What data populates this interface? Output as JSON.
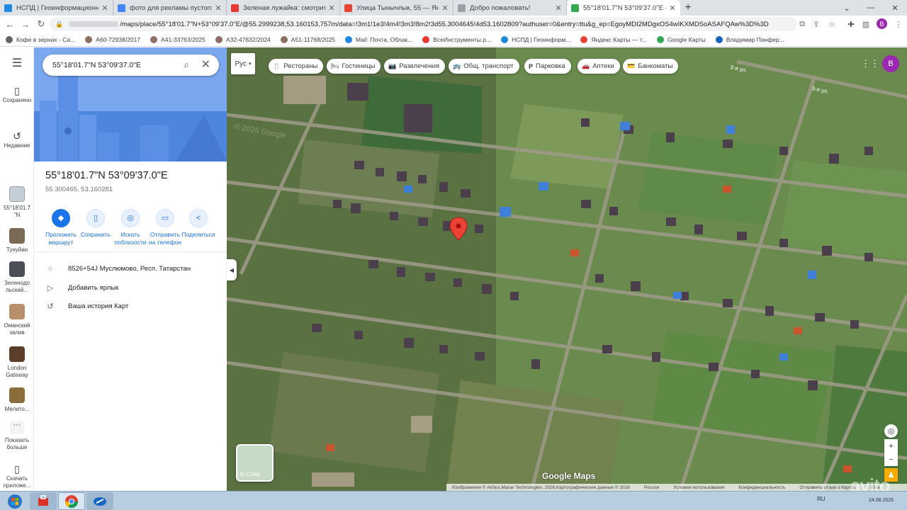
{
  "browser": {
    "tabs": [
      {
        "title": "НСПД | Геоинформационный п",
        "icon_color": "#1e88e5",
        "close": "✕"
      },
      {
        "title": "фото для рекламы пустого учас",
        "icon_color": "#4285f4",
        "close": "✕"
      },
      {
        "title": "Зеленая лужайка: смотрите и с",
        "icon_color": "#e53935",
        "close": "✕"
      },
      {
        "title": "Улица Тынычлык, 55 — Яндекс",
        "icon_color": "#ea4335",
        "close": "✕"
      },
      {
        "title": "Добро пожаловать!",
        "icon_color": "#9aa0a6",
        "close": "✕"
      },
      {
        "title": "55°18'01.7\"N 53°09'37.0\"E – Goo",
        "icon_color": "#34a853",
        "close": "✕",
        "active": true
      }
    ],
    "new_tab": "+",
    "url_visible": "/maps/place/55°18'01.7\"N+53°09'37.0\"E/@55.2999238,53.160153,757m/data=!3m1!1e3!4m4!3m3!8m2!3d55.3004645!4d53.1602809?authuser=0&entry=ttu&g_ep=EgoyMDI2MDgxOS4wIKXMDSoASAFQAw%3D%3D",
    "profile_letter": "B",
    "bookmarks": [
      {
        "label": "Кофе в зернах - Са...",
        "color": "#5f6368"
      },
      {
        "label": "А60-72938/2017",
        "color": "#8d6e63"
      },
      {
        "label": "А41-33763/2025",
        "color": "#8d6e63"
      },
      {
        "label": "А32-47632/2024",
        "color": "#8d6e63"
      },
      {
        "label": "А51-11768/2025",
        "color": "#8d6e63"
      },
      {
        "label": "Mail: Почта, Облак...",
        "color": "#1e88e5"
      },
      {
        "label": "ВсеИнструменты.р...",
        "color": "#e53935"
      },
      {
        "label": "НСПД | Геоинформ...",
        "color": "#1e88e5"
      },
      {
        "label": "Яндекс Карты — т...",
        "color": "#ea4335"
      },
      {
        "label": "Google Карты",
        "color": "#34a853"
      },
      {
        "label": "Владимир Панфер...",
        "color": "#1565c0"
      }
    ]
  },
  "rail": {
    "saved": "Сохранено",
    "recent": "Недавние",
    "items": [
      {
        "label": "55°18'01.7 \"N",
        "color": "#c5cfd8"
      },
      {
        "label": "Тунуйан",
        "color": "#7a6a55"
      },
      {
        "label": "Зеленодольский...",
        "color": "#4a4f58"
      },
      {
        "label": "Оманский залив",
        "color": "#b88f6b"
      },
      {
        "label": "London Gateway",
        "color": "#5a3e2b"
      },
      {
        "label": "Мелито...",
        "color": "#8a6d3b"
      }
    ],
    "more": "Показать больше",
    "download": "Скачать приложе..."
  },
  "panel": {
    "search_value": "55°18'01.7\"N 53°09'37.0\"E",
    "title": "55°18'01.7\"N 53°09'37.0\"E",
    "coords": "55.300465, 53.160281",
    "actions": [
      {
        "label": "Проложить маршрут",
        "icon": "◆"
      },
      {
        "label": "Сохранить",
        "icon": "▯"
      },
      {
        "label": "Искать поблизости",
        "icon": "◎"
      },
      {
        "label": "Отправить на телефон",
        "icon": "▭"
      },
      {
        "label": "Поделиться",
        "icon": "<"
      }
    ],
    "info_rows": [
      {
        "text": "8526+54J Муслюмово, Респ. Татарстан",
        "icon": "⁘"
      },
      {
        "text": "Добавить ярлык",
        "icon": "▷"
      },
      {
        "text": "Ваша история Карт",
        "icon": "↺"
      }
    ]
  },
  "map": {
    "lang_button": "Рус",
    "chips": [
      {
        "label": "Рестораны",
        "icon": "🍴"
      },
      {
        "label": "Гостиницы",
        "icon": "🛏"
      },
      {
        "label": "Развлечения",
        "icon": "📷"
      },
      {
        "label": "Общ. транспорт",
        "icon": "🚌"
      },
      {
        "label": "Парковка",
        "icon": "P"
      },
      {
        "label": "Аптеки",
        "icon": "🚗"
      },
      {
        "label": "Банкоматы",
        "icon": "💳"
      }
    ],
    "street_labels": [
      "3-я ул.",
      "3-я ул."
    ],
    "layers_label": "Слои",
    "logo": "Google Maps",
    "watermark_faint": "© 2026 Google",
    "attribution": [
      "Изображения © Airbus,Maxar Technologies, 2026,Картографические данные © 2026",
      "Россия",
      "Условия использования",
      "Конфиденциальность",
      "Отправить отзыв о Картах",
      "50 м"
    ],
    "avito_watermark": "avito",
    "controls": {
      "locate": "◎",
      "zoom_in": "+",
      "zoom_out": "−"
    }
  },
  "taskbar": {
    "lang": "RU",
    "date": "24.08.2026"
  }
}
